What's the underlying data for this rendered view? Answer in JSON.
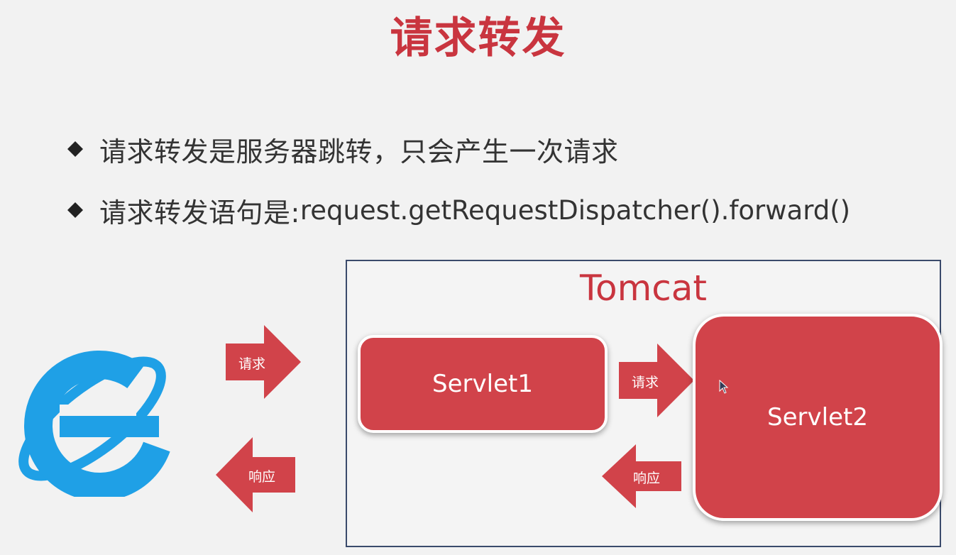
{
  "slide": {
    "title": "请求转发",
    "bullets": [
      {
        "text": "请求转发是服务器跳转，只会产生一次请求"
      },
      {
        "prefix": "请求转发语句是: ",
        "code": "request.getRequestDispatcher().forward()"
      }
    ]
  },
  "diagram": {
    "container_title": "Tomcat",
    "servlet1": "Servlet1",
    "servlet2": "Servlet2",
    "browser_request_label": "请求",
    "browser_response_label": "响应",
    "forward_label": "请求",
    "servlet_response_label": "响应",
    "icons": {
      "browser": "internet-explorer-icon",
      "cursor": "mouse-cursor-icon"
    }
  },
  "colors": {
    "accent": "#c9353f",
    "box_fill": "#d1434a",
    "frame": "#3a4a6b",
    "ie_blue": "#1fa0e6"
  }
}
